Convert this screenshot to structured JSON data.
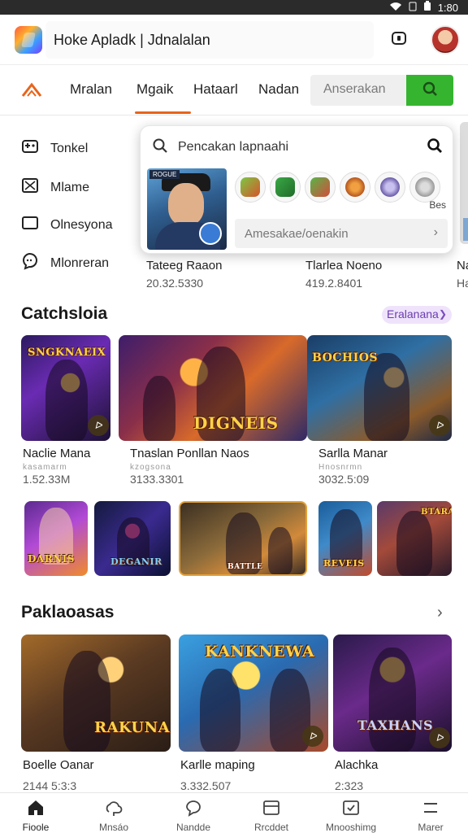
{
  "status_bar": {
    "time": "1:80"
  },
  "header": {
    "title": "Hoke Apladk | Jdnalalan"
  },
  "categories": {
    "tabs": [
      {
        "label": "Mralan"
      },
      {
        "label": "Mgaik"
      },
      {
        "label": "Hataarl"
      },
      {
        "label": "Nadan"
      }
    ],
    "search_placeholder": "Anserakan"
  },
  "sidebar": {
    "items": [
      {
        "label": "Tonkel",
        "icon": "gamepad-icon"
      },
      {
        "label": "Mlame",
        "icon": "box-icon"
      },
      {
        "label": "Olnesyona",
        "icon": "tablet-icon"
      },
      {
        "label": "Mlonreran",
        "icon": "chat-icon"
      }
    ]
  },
  "dropdown": {
    "query": "Pencakan lapnaahi",
    "hero_tag": "ROGUE",
    "more_label": "Bes",
    "suggestion": "Amesakae/oenakin"
  },
  "behind_cards": [
    {
      "title": "Tateeg Raaon",
      "sub": "20.32.5330"
    },
    {
      "title": "Tlarlea Noeno",
      "sub": "419.2.8401"
    },
    {
      "title": "Na",
      "sub": "Ha"
    }
  ],
  "section1": {
    "title": "Catchsloia",
    "pill": "Eralanana",
    "cards": [
      {
        "title": "Naclie Mana",
        "sub": "1.52.33M",
        "meta": "kasamarm",
        "logo": "SNGKNAEIX"
      },
      {
        "title": "Tnaslan Ponllan Naos",
        "sub": "3133.3301",
        "meta": "kzogsona",
        "logo": "DIGNEIS"
      },
      {
        "title": "Sarlla Manar",
        "sub": "3032.5:09",
        "meta": "Hnosnrmn",
        "logo": "BOCHIOS"
      }
    ],
    "thumbs": [
      {
        "logo": "DARNIS"
      },
      {
        "logo": "DEGANIR"
      },
      {
        "logo": "BATTLE"
      },
      {
        "logo": "REVEIS"
      },
      {
        "logo": "BTARA"
      }
    ]
  },
  "section2": {
    "title": "Paklaoasas",
    "cards": [
      {
        "title": "Boelle Oanar",
        "sub": "2144 5:3:3",
        "logo": "RAKUNA"
      },
      {
        "title": "Karlle maping",
        "sub": "3.332.507",
        "logo": "KANKNEWA"
      },
      {
        "title": "Alachka",
        "sub": "2:323",
        "logo": "TAXHANS"
      }
    ]
  },
  "bottom_nav": [
    {
      "label": "Fioole",
      "icon": "home-icon"
    },
    {
      "label": "Mnsáo",
      "icon": "cloud-icon"
    },
    {
      "label": "Nandde",
      "icon": "chat-bubble-icon"
    },
    {
      "label": "Rrcddet",
      "icon": "card-icon"
    },
    {
      "label": "Mnooshimg",
      "icon": "check-card-icon"
    },
    {
      "label": "Marer",
      "icon": "menu-icon"
    }
  ],
  "colors": {
    "accent": "#e8641b",
    "search_button": "#35b52f",
    "pill_bg": "#efe3fb"
  }
}
